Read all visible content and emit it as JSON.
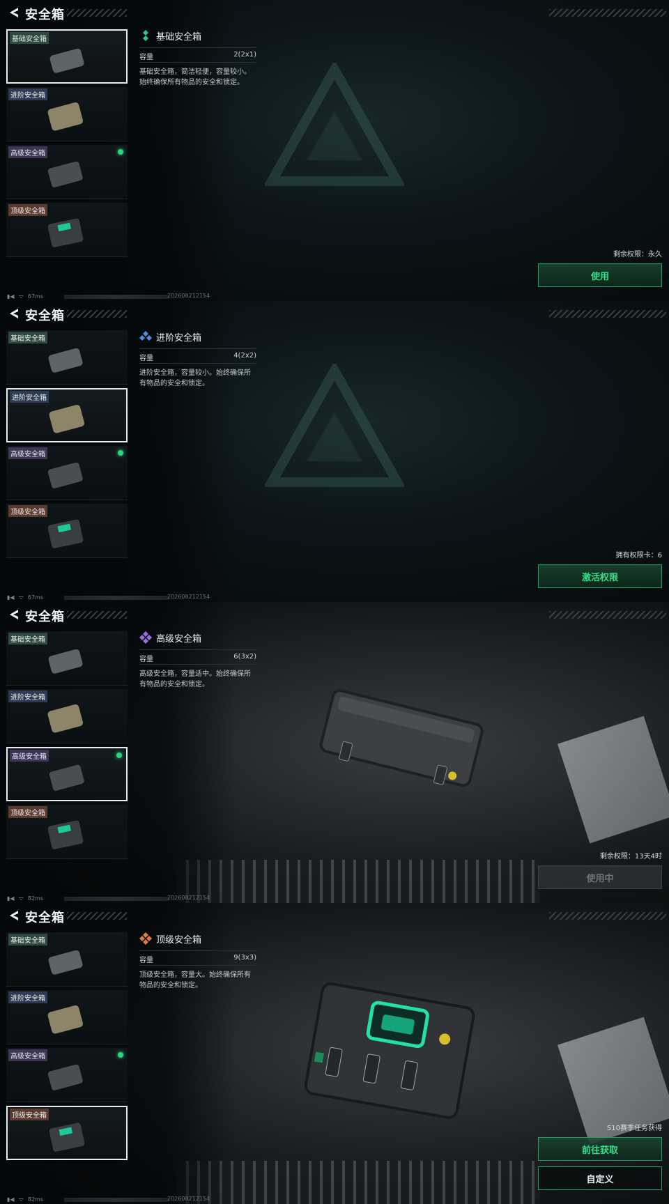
{
  "panels": [
    {
      "title": "安全箱",
      "selected": "基础安全箱",
      "list": [
        {
          "label": "基础安全箱",
          "dot": false
        },
        {
          "label": "进阶安全箱",
          "dot": false
        },
        {
          "label": "高级安全箱",
          "dot": true
        },
        {
          "label": "顶级安全箱",
          "dot": false
        }
      ],
      "detail": {
        "name": "基础安全箱",
        "capacity_label": "容量",
        "capacity_value": "2(2x1)",
        "description": "基础安全箱，简洁轻便，容量较小。始终确保所有物品的安全和锁定。"
      },
      "right_text": "剩余权限：永久",
      "buttons": [
        "使用"
      ],
      "status": {
        "ping": "67ms",
        "stamp": "20260821215 4"
      }
    },
    {
      "title": "安全箱",
      "selected": "进阶安全箱",
      "list": [
        {
          "label": "基础安全箱",
          "dot": false
        },
        {
          "label": "进阶安全箱",
          "dot": false
        },
        {
          "label": "高级安全箱",
          "dot": true
        },
        {
          "label": "顶级安全箱",
          "dot": false
        }
      ],
      "detail": {
        "name": "进阶安全箱",
        "capacity_label": "容量",
        "capacity_value": "4(2x2)",
        "description": "进阶安全箱，容量较小。始终确保所有物品的安全和锁定。"
      },
      "right_text": "拥有权限卡：6",
      "buttons": [
        "激活权限"
      ],
      "status": {
        "ping": "67ms",
        "stamp": "202608212154"
      }
    },
    {
      "title": "安全箱",
      "selected": "高级安全箱",
      "list": [
        {
          "label": "基础安全箱",
          "dot": false
        },
        {
          "label": "进阶安全箱",
          "dot": false
        },
        {
          "label": "高级安全箱",
          "dot": true
        },
        {
          "label": "顶级安全箱",
          "dot": false
        }
      ],
      "detail": {
        "name": "高级安全箱",
        "capacity_label": "容量",
        "capacity_value": "6(3x2)",
        "description": "高级安全箱，容量适中。始终确保所有物品的安全和锁定。"
      },
      "right_text": "剩余权限：13天4时",
      "buttons": [
        "使用中"
      ],
      "status": {
        "ping": "82ms",
        "stamp": "202608212154"
      }
    },
    {
      "title": "安全箱",
      "selected": "顶级安全箱",
      "list": [
        {
          "label": "基础安全箱",
          "dot": false
        },
        {
          "label": "进阶安全箱",
          "dot": false
        },
        {
          "label": "高级安全箱",
          "dot": true
        },
        {
          "label": "顶级安全箱",
          "dot": false
        }
      ],
      "detail": {
        "name": "顶级安全箱",
        "capacity_label": "容量",
        "capacity_value": "9(3x3)",
        "description": "顶级安全箱，容量大。始终确保所有物品的安全和锁定。"
      },
      "right_text": "S10赛季任务获得",
      "buttons": [
        "前往获取",
        "自定义"
      ],
      "status": {
        "ping": "82ms",
        "stamp": "202608212154"
      }
    }
  ],
  "colors": {
    "accent_green": "#36e08a",
    "tier_basic": "#2d4a3f",
    "tier_advanced": "#2c3b52",
    "tier_high": "#3e3456",
    "tier_top": "#5a3a2c"
  }
}
